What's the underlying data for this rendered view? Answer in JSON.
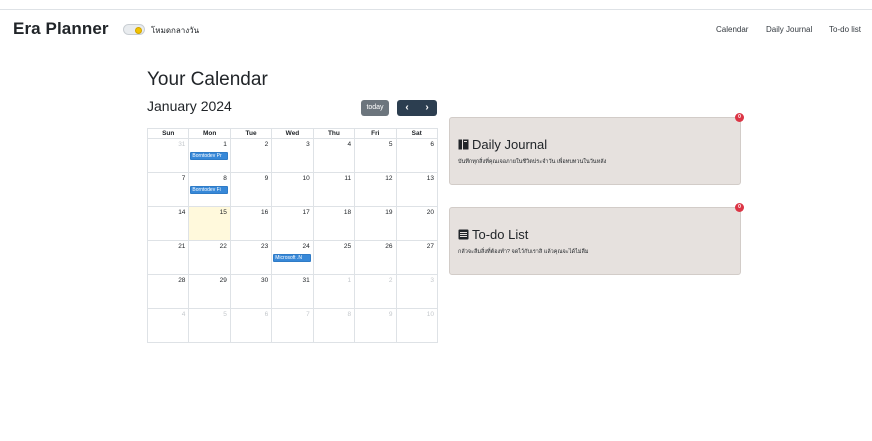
{
  "header": {
    "brand": "Era Planner",
    "theme_toggle_label": "โหมดกลางวัน",
    "nav": [
      "Calendar",
      "Daily Journal",
      "To-do list"
    ]
  },
  "calendar": {
    "title": "Your Calendar",
    "month_label": "January 2024",
    "today_label": "today",
    "prev_symbol": "‹",
    "next_symbol": "›",
    "weekdays": [
      "Sun",
      "Mon",
      "Tue",
      "Wed",
      "Thu",
      "Fri",
      "Sat"
    ],
    "weeks": [
      [
        {
          "d": "31",
          "other": true
        },
        {
          "d": "1",
          "event": "Borntodev Pr"
        },
        {
          "d": "2"
        },
        {
          "d": "3"
        },
        {
          "d": "4"
        },
        {
          "d": "5"
        },
        {
          "d": "6"
        }
      ],
      [
        {
          "d": "7"
        },
        {
          "d": "8",
          "event": "Borntodev Fi"
        },
        {
          "d": "9"
        },
        {
          "d": "10"
        },
        {
          "d": "11"
        },
        {
          "d": "12"
        },
        {
          "d": "13"
        }
      ],
      [
        {
          "d": "14"
        },
        {
          "d": "15",
          "today": true
        },
        {
          "d": "16"
        },
        {
          "d": "17"
        },
        {
          "d": "18"
        },
        {
          "d": "19"
        },
        {
          "d": "20"
        }
      ],
      [
        {
          "d": "21"
        },
        {
          "d": "22"
        },
        {
          "d": "23"
        },
        {
          "d": "24",
          "event": "Microsoft .N"
        },
        {
          "d": "25"
        },
        {
          "d": "26"
        },
        {
          "d": "27"
        }
      ],
      [
        {
          "d": "28"
        },
        {
          "d": "29"
        },
        {
          "d": "30"
        },
        {
          "d": "31"
        },
        {
          "d": "1",
          "other": true
        },
        {
          "d": "2",
          "other": true
        },
        {
          "d": "3",
          "other": true
        }
      ],
      [
        {
          "d": "4",
          "other": true
        },
        {
          "d": "5",
          "other": true
        },
        {
          "d": "6",
          "other": true
        },
        {
          "d": "7",
          "other": true
        },
        {
          "d": "8",
          "other": true
        },
        {
          "d": "9",
          "other": true
        },
        {
          "d": "10",
          "other": true
        }
      ]
    ],
    "event_color": "#3788d8",
    "today_color": "#fff9dc"
  },
  "cards": {
    "journal": {
      "title": "Daily Journal",
      "description": "บันทึกทุกสิ่งที่คุณเจอภายในชีวิตประจำวัน เพื่อทบทวนในวันหลัง",
      "badge": "0",
      "icon": "journal-book-icon"
    },
    "todo": {
      "title": "To-do List",
      "description": "กลัวจะลืมสิ่งที่ต้องทำ? จดไว้กับเราสิ แล้วคุณจะได้ไม่ลืม",
      "badge": "0",
      "icon": "list-icon"
    }
  },
  "colors": {
    "card_bg": "#e6e1de",
    "badge": "#dc3545",
    "nav_button": "#2c3e50",
    "today_button": "#6c757d"
  }
}
